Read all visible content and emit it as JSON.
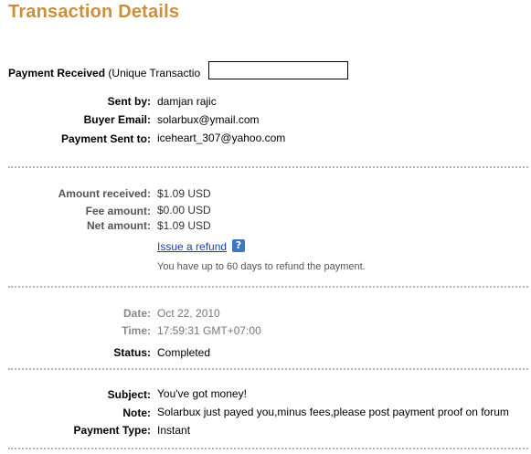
{
  "page": {
    "title": "Transaction Details"
  },
  "payment_received": {
    "label": "Payment Received",
    "detail": "(Unique Transactio"
  },
  "sender": {
    "sent_by": {
      "label": "Sent by:",
      "value": "damjan rajic"
    },
    "buyer_email": {
      "label": "Buyer Email:",
      "value": "solarbux@ymail.com"
    },
    "payment_sent_to": {
      "label": "Payment Sent to:",
      "value": "iceheart_307@yahoo.com"
    }
  },
  "amounts": {
    "received": {
      "label": "Amount received:",
      "value": "$1.09 USD"
    },
    "fee": {
      "label": "Fee amount:",
      "value": "$0.00 USD"
    },
    "net": {
      "label": "Net amount:",
      "value": "$1.09 USD"
    },
    "refund_link": "Issue a refund",
    "help_icon": "?",
    "refund_note": "You have up to 60 days to refund the payment."
  },
  "timing": {
    "date": {
      "label": "Date:",
      "value": "Oct 22, 2010"
    },
    "time": {
      "label": "Time:",
      "value": "17:59:31 GMT+07:00"
    },
    "status": {
      "label": "Status:",
      "value": "Completed"
    }
  },
  "message": {
    "subject": {
      "label": "Subject:",
      "value": "You've got money!"
    },
    "note": {
      "label": "Note:",
      "value": "Solarbux just payed you,minus fees,please post payment proof on forum"
    },
    "payment_type": {
      "label": "Payment Type:",
      "value": "Instant"
    }
  },
  "colors": {
    "title": "#c98f3a",
    "link": "#1a3fa8",
    "help_icon_bg": "#3a78c4",
    "separator": "#b5b5b5"
  },
  "icons": {
    "help": "question-mark-icon"
  }
}
